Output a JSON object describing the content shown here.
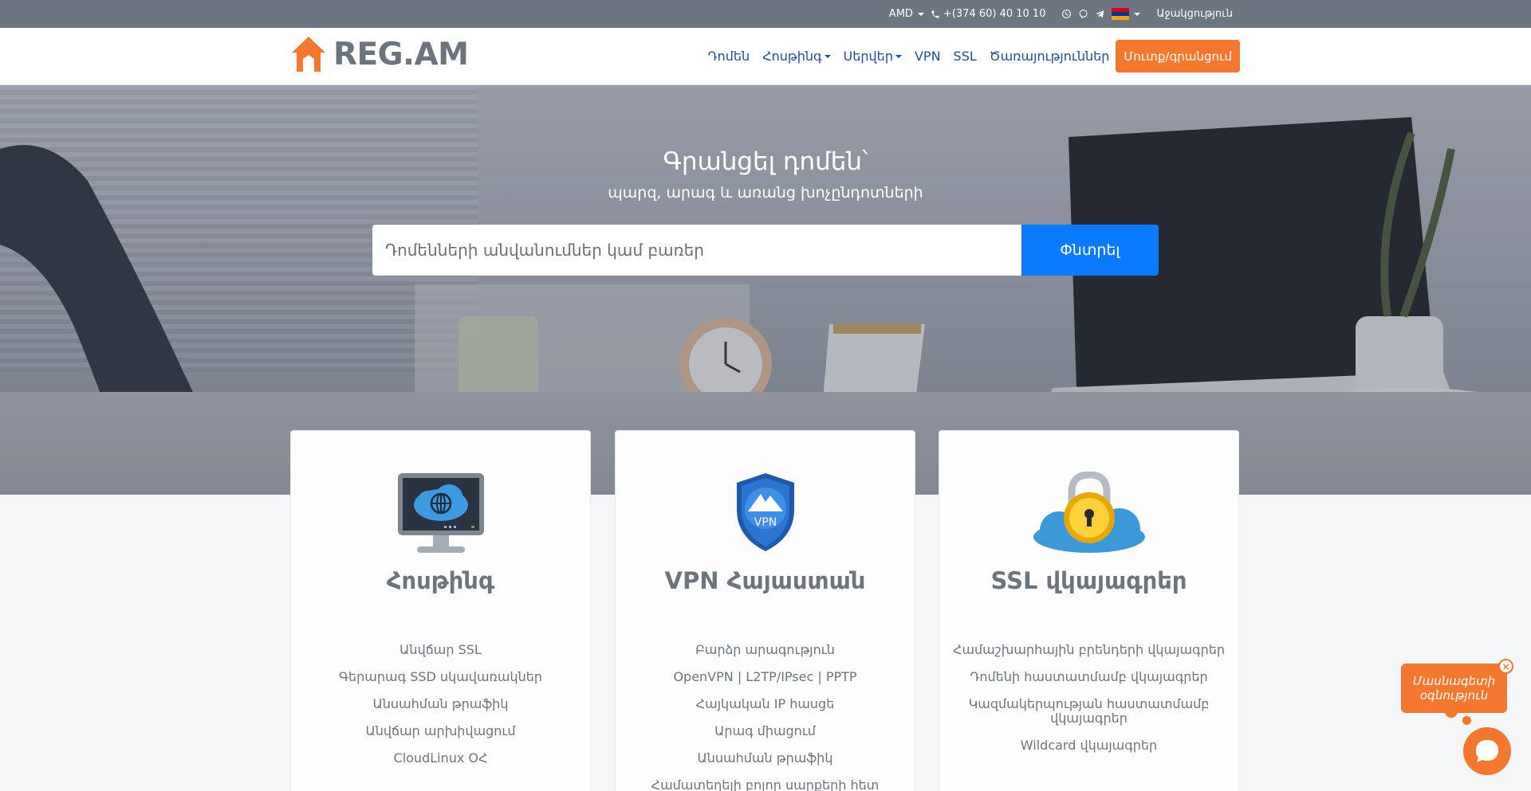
{
  "topbar": {
    "currency": "AMD",
    "phone": "+(374 60) 40 10 10",
    "icons": [
      "phone-icon",
      "whatsapp-icon",
      "viber-icon",
      "telegram-icon"
    ],
    "contact_label": "Աջակցություն"
  },
  "navbar": {
    "logo_text": "REG.AM",
    "links": [
      "Դոմեն",
      "Հոսթինգ",
      "Սերվեր",
      "VPN",
      "SSL",
      "Ծառայություններ"
    ],
    "login_label": "Մուտք/գրանցում"
  },
  "hero": {
    "title": "Գրանցել դոմեն՝",
    "subtitle": "պարզ, արագ և առանց խոչընդոտների",
    "search_placeholder": "Դոմենների անվանումներ կամ բառեր",
    "search_button": "Փնտրել"
  },
  "cards": [
    {
      "title": "Հոսթինգ",
      "icon": "hosting-monitor-icon",
      "features": [
        "Անվճար SSL",
        "Գերարագ SSD սկավառակներ",
        "Անսահման թրաֆիկ",
        "Անվճար արխիվացում",
        "CloudLinux ՕՀ"
      ]
    },
    {
      "title": "VPN Հայաստան",
      "icon": "vpn-shield-icon",
      "features": [
        "Բարձր արագություն",
        "OpenVPN | L2TP/IPsec | PPTP",
        "Հայկական IP հասցե",
        "Արագ միացում",
        "Անսահման թրաֆիկ",
        "Համատեղելի բոլոր սարքերի հետ"
      ]
    },
    {
      "title": "SSL վկայագրեր",
      "icon": "ssl-lock-cloud-icon",
      "features": [
        "Համաշխարհային բրենդերի վկայագրեր",
        "Դոմենի հաստատմամբ վկայագրեր",
        "Կազմակերպության հաստատմամբ վկայագրեր",
        "Wildcard վկայագրեր"
      ]
    }
  ],
  "chat": {
    "bubble_text": "Մասնագետի օգնություն",
    "close_label": "×"
  },
  "colors": {
    "accent": "#f3772c",
    "primary": "#0a7bff",
    "nav_link": "#1f4e9e",
    "topbar_bg": "#6d7680"
  }
}
